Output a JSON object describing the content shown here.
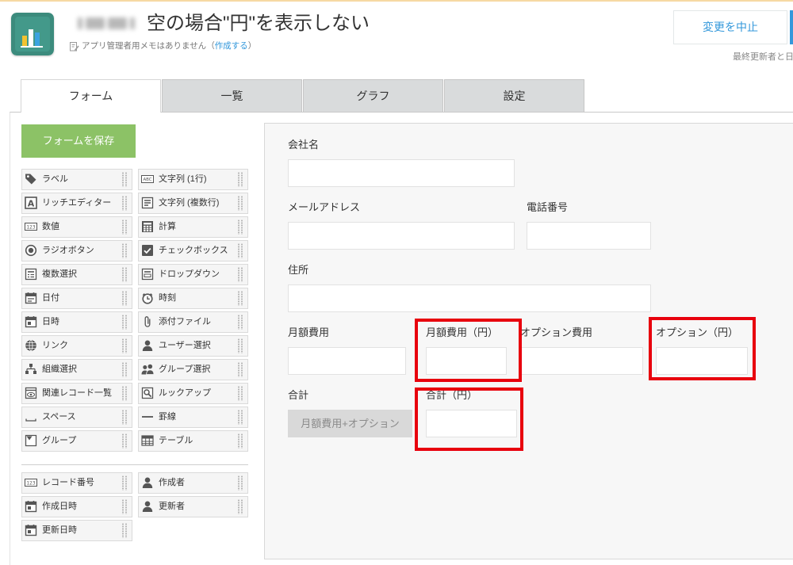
{
  "header": {
    "app_icon": "bar-chart-app-icon",
    "title": "空の場合\"円\"を表示しない",
    "memo_text": "アプリ管理者用メモはありません",
    "memo_link_open": "（",
    "memo_link": "作成する",
    "memo_link_close": "）",
    "cancel_button": "変更を中止",
    "last_updated": "最終更新者と日"
  },
  "tabs": [
    {
      "label": "フォーム",
      "active": true
    },
    {
      "label": "一覧",
      "active": false
    },
    {
      "label": "グラフ",
      "active": false
    },
    {
      "label": "設定",
      "active": false
    }
  ],
  "palette": {
    "save_button": "フォームを保存",
    "fields": [
      {
        "label": "ラベル",
        "icon": "tag-icon"
      },
      {
        "label": "文字列 (1行)",
        "icon": "text-single-line-icon"
      },
      {
        "label": "リッチエディター",
        "icon": "rich-editor-icon"
      },
      {
        "label": "文字列 (複数行)",
        "icon": "text-multi-line-icon"
      },
      {
        "label": "数値",
        "icon": "number-icon"
      },
      {
        "label": "計算",
        "icon": "calculator-icon"
      },
      {
        "label": "ラジオボタン",
        "icon": "radio-icon"
      },
      {
        "label": "チェックボックス",
        "icon": "checkbox-icon"
      },
      {
        "label": "複数選択",
        "icon": "multi-select-icon"
      },
      {
        "label": "ドロップダウン",
        "icon": "dropdown-icon"
      },
      {
        "label": "日付",
        "icon": "date-icon"
      },
      {
        "label": "時刻",
        "icon": "time-icon"
      },
      {
        "label": "日時",
        "icon": "datetime-icon"
      },
      {
        "label": "添付ファイル",
        "icon": "attachment-icon"
      },
      {
        "label": "リンク",
        "icon": "link-icon"
      },
      {
        "label": "ユーザー選択",
        "icon": "user-icon"
      },
      {
        "label": "組織選択",
        "icon": "organization-icon"
      },
      {
        "label": "グループ選択",
        "icon": "group-select-icon"
      },
      {
        "label": "関連レコード一覧",
        "icon": "related-records-icon"
      },
      {
        "label": "ルックアップ",
        "icon": "lookup-icon"
      },
      {
        "label": "スペース",
        "icon": "space-icon"
      },
      {
        "label": "罫線",
        "icon": "border-line-icon"
      },
      {
        "label": "グループ",
        "icon": "group-icon"
      },
      {
        "label": "テーブル",
        "icon": "table-icon"
      }
    ],
    "system_fields": [
      {
        "label": "レコード番号",
        "icon": "number-icon"
      },
      {
        "label": "作成者",
        "icon": "user-icon"
      },
      {
        "label": "作成日時",
        "icon": "datetime-icon"
      },
      {
        "label": "更新者",
        "icon": "user-icon"
      },
      {
        "label": "更新日時",
        "icon": "datetime-icon"
      }
    ],
    "icon_glyphs": {
      "text-single-line-icon": "ABC",
      "rich-editor-icon": "A",
      "number-icon": "123"
    }
  },
  "form": {
    "company": {
      "label": "会社名",
      "value": ""
    },
    "email": {
      "label": "メールアドレス",
      "value": ""
    },
    "phone": {
      "label": "電話番号",
      "value": ""
    },
    "address": {
      "label": "住所",
      "value": ""
    },
    "monthly_fee": {
      "label": "月額費用",
      "value": ""
    },
    "monthly_fee_yen": {
      "label": "月額費用（円）",
      "value": ""
    },
    "option_fee": {
      "label": "オプション費用",
      "value": ""
    },
    "option_yen": {
      "label": "オプション（円）",
      "value": ""
    },
    "total": {
      "label": "合計",
      "formula": "月額費用+オプション"
    },
    "total_yen": {
      "label": "合計（円）",
      "value": ""
    }
  },
  "colors": {
    "accent": "#3498db",
    "save_button": "#8cc266",
    "highlight": "#e8000d",
    "app_icon": "#3c8b7d"
  }
}
